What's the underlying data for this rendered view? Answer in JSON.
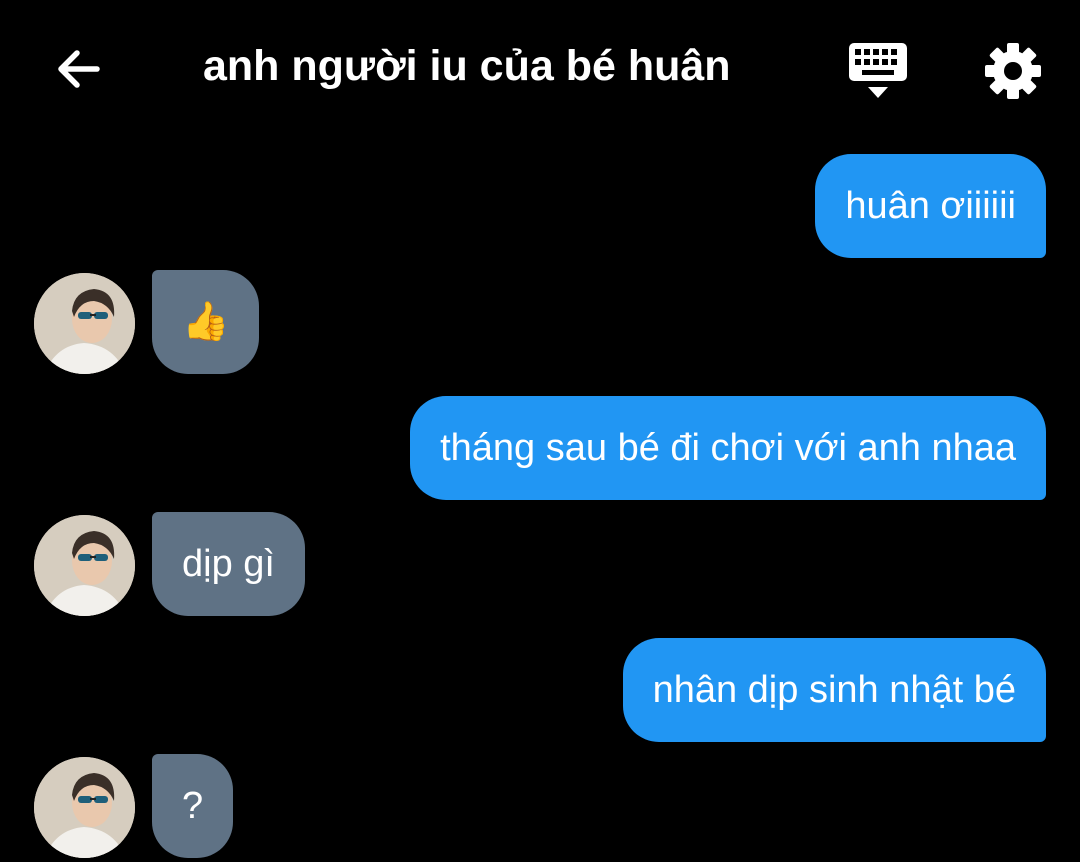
{
  "header": {
    "title": "anh người iu của bé huân",
    "back_icon": "arrow-left-icon",
    "keyboard_icon": "keyboard-icon",
    "settings_icon": "gear-icon"
  },
  "colors": {
    "background": "#000000",
    "outgoing_bubble": "#2196f3",
    "incoming_bubble": "#5f7285",
    "text": "#ffffff"
  },
  "messages": [
    {
      "direction": "outgoing",
      "text": "huân ơiiiiii"
    },
    {
      "direction": "incoming",
      "text": "👍"
    },
    {
      "direction": "outgoing",
      "text": "tháng sau bé đi chơi với anh nhaa"
    },
    {
      "direction": "incoming",
      "text": "dịp gì"
    },
    {
      "direction": "outgoing",
      "text": "nhân dịp sinh nhật bé"
    },
    {
      "direction": "incoming",
      "text": "?"
    }
  ]
}
